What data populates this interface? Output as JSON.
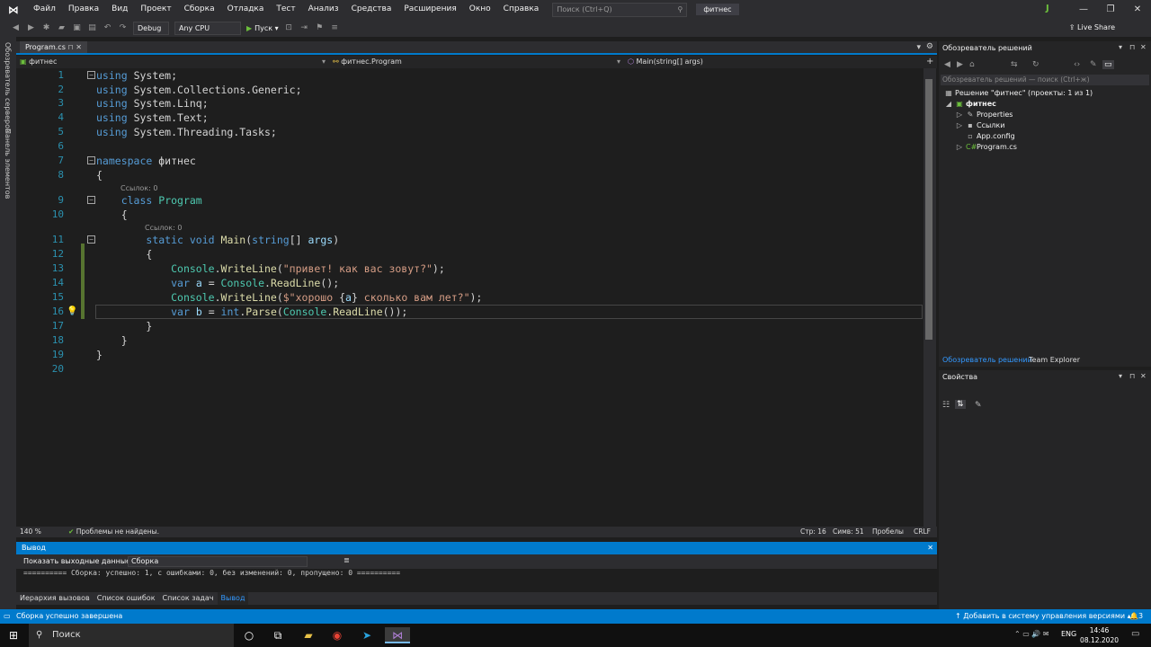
{
  "menu": [
    "Файл",
    "Правка",
    "Вид",
    "Проект",
    "Сборка",
    "Отладка",
    "Тест",
    "Анализ",
    "Средства",
    "Расширения",
    "Окно",
    "Справка"
  ],
  "search_placeholder": "Поиск (Ctrl+Q)",
  "solution_badge": "фитнес",
  "user_initial": "J",
  "toolbar": {
    "config": "Debug",
    "platform": "Any CPU",
    "start": "Пуск",
    "liveshare": "Live Share"
  },
  "left_strip": [
    "Обозреватель серверов",
    "Панель элементов"
  ],
  "doc_tab": "Program.cs",
  "nav": {
    "project": "фитнес",
    "class": "фитнес.Program",
    "member": "Main(string[] args)"
  },
  "code_refs": [
    "Ссылок: 0",
    "Ссылок: 0"
  ],
  "code_lines": [
    {
      "n": "1"
    },
    {
      "n": "2"
    },
    {
      "n": "3"
    },
    {
      "n": "4"
    },
    {
      "n": "5"
    },
    {
      "n": "6"
    },
    {
      "n": "7"
    },
    {
      "n": "8"
    },
    {
      "n": "9"
    },
    {
      "n": "10"
    },
    {
      "n": "11"
    },
    {
      "n": "12"
    },
    {
      "n": "13"
    },
    {
      "n": "14"
    },
    {
      "n": "15"
    },
    {
      "n": "16"
    },
    {
      "n": "17"
    },
    {
      "n": "18"
    },
    {
      "n": "19"
    },
    {
      "n": "20"
    }
  ],
  "editor_status": {
    "zoom": "140 %",
    "problems": "Проблемы не найдены.",
    "line": "Стр: 16",
    "col": "Симв: 51",
    "spaces": "Пробелы",
    "eol": "CRLF"
  },
  "output": {
    "title": "Вывод",
    "source_label": "Показать выходные данные из:",
    "source_value": "Сборка",
    "text": "========== Сборка: успешно: 1, с ошибками: 0, без изменений: 0, пропущено: 0 =========="
  },
  "bottom_tabs": [
    "Иерархия вызовов",
    "Список ошибок",
    "Список задач",
    "Вывод"
  ],
  "solution_explorer": {
    "title": "Обозреватель решений",
    "search": "Обозреватель решений — поиск (Ctrl+ж)",
    "solution": "Решение \"фитнес\" (проекты: 1 из 1)",
    "project": "фитнес",
    "items": [
      "Properties",
      "Ссылки",
      "App.config",
      "Program.cs"
    ],
    "tabs": [
      "Обозреватель решений",
      "Team Explorer"
    ]
  },
  "properties": {
    "title": "Свойства"
  },
  "statusbar": {
    "left": "Сборка успешно завершена",
    "right": "Добавить в систему управления версиями",
    "badge": "3"
  },
  "taskbar": {
    "search": "Поиск",
    "lang": "ENG",
    "time": "14:46",
    "date": "08.12.2020"
  }
}
